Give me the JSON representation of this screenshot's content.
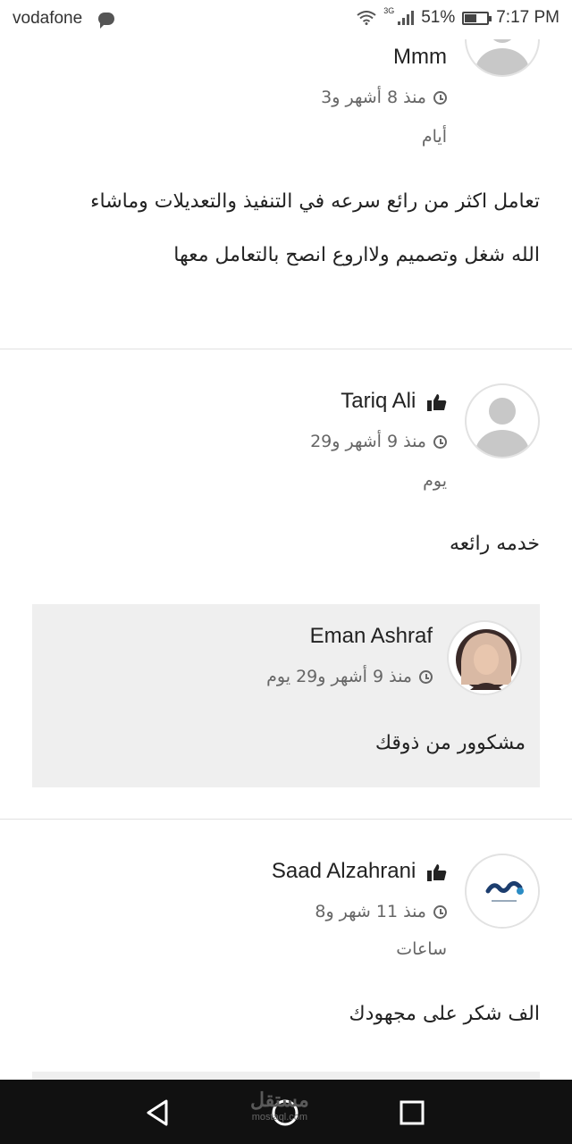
{
  "status_bar": {
    "carrier": "vodafone",
    "network": "3G",
    "battery": "51%",
    "battery_level": 0.51,
    "time": "7:17 PM",
    "icons": [
      "chat-icon",
      "wifi-icon",
      "signal-icon",
      "battery-icon"
    ]
  },
  "comments": [
    {
      "name": "Mmm",
      "date_line1": "منذ 8 أشهر و3",
      "date_line2": "أيام",
      "text_line1": "تعامل اكثر من رائع سرعه في التنفيذ والتعديلات وماشاء",
      "text_line2": "الله شغل وتصميم ولااروع انصح بالتعامل معها"
    },
    {
      "name": "Tariq Ali",
      "date_line1": "منذ 9 أشهر و29",
      "date_line2": "يوم",
      "text": "خدمه رائعه",
      "reply": {
        "name": "Eman Ashraf",
        "date": "منذ 9 أشهر و29 يوم",
        "text": "مشكوور من ذوقك"
      }
    },
    {
      "name": "Saad Alzahrani",
      "date_line1": "منذ 11 شهر و8",
      "date_line2": "ساعات",
      "text": "الف شكر على مجهودك"
    }
  ],
  "nav_bar": {
    "watermark_ar": "مستقل",
    "watermark_en": "mostaql.com",
    "icons": [
      "back-icon",
      "home-icon",
      "recents-icon"
    ]
  },
  "colors": {
    "reply_background": "#efefef",
    "divider": "#e1e1e1",
    "nav_background": "#111111"
  }
}
